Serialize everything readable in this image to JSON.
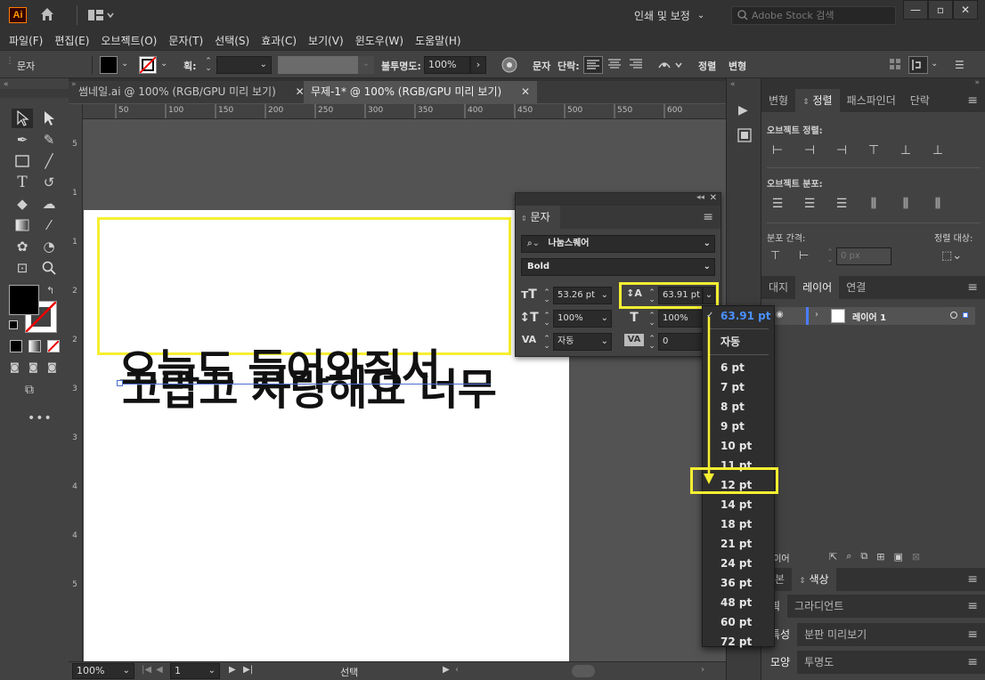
{
  "app": {
    "logo": "Ai",
    "workspace": "인쇄 및 보정",
    "stock_search_placeholder": "Adobe Stock 검색"
  },
  "menu": [
    "파일(F)",
    "편집(E)",
    "오브젝트(O)",
    "문자(T)",
    "선택(S)",
    "효과(C)",
    "보기(V)",
    "윈도우(W)",
    "도움말(H)"
  ],
  "control_bar": {
    "selection_label": "문자",
    "stroke_label": "획:",
    "opacity_label": "불투명도:",
    "opacity_value": "100%",
    "char_label": "문자",
    "para_label": "단락:",
    "align_label": "정렬",
    "transform_label": "변형",
    "fill_color": "#000000",
    "stroke_color": "#ffffff"
  },
  "tabs": [
    {
      "label": "썸네일.ai @ 100% (RGB/GPU 미리 보기)",
      "active": false
    },
    {
      "label": "무제-1* @ 100% (RGB/GPU 미리 보기)",
      "active": true
    }
  ],
  "ruler_top": [
    "50",
    "100",
    "150",
    "200",
    "250",
    "300",
    "350",
    "400",
    "450",
    "500",
    "550",
    "600"
  ],
  "ruler_left": [
    "5",
    "1",
    "1",
    "2",
    "2",
    "3",
    "3",
    "4",
    "4",
    "5"
  ],
  "artboard_text": {
    "line1": "오늘도 들어와줘서",
    "line2": "고맙고 사랑해요 너무"
  },
  "status_bar": {
    "zoom": "100%",
    "page": "1",
    "tool": "선택"
  },
  "char_panel": {
    "title": "문자",
    "font_family": "나눔스퀘어",
    "font_style": "Bold",
    "font_size": "53.26 pt",
    "leading": "63.91 pt",
    "vertical_scale": "100%",
    "horizontal_scale": "100%",
    "kerning": "자동",
    "tracking": "0"
  },
  "leading_dropdown": {
    "selected": "63.91 pt",
    "auto": "자동",
    "options": [
      "6 pt",
      "7 pt",
      "8 pt",
      "9 pt",
      "10 pt",
      "11 pt",
      "12 pt",
      "14 pt",
      "18 pt",
      "21 pt",
      "24 pt",
      "36 pt",
      "48 pt",
      "60 pt",
      "72 pt"
    ],
    "highlighted": "12 pt"
  },
  "right_panel": {
    "tabs1": [
      "변형",
      "정렬",
      "패스파인더",
      "단락"
    ],
    "active_tab1": "정렬",
    "align_objects_label": "오브젝트 정렬:",
    "distribute_objects_label": "오브젝트 분포:",
    "distribute_spacing_label": "분포 간격:",
    "align_to_label": "정렬 대상:",
    "spacing_value": "0 px",
    "tabs2": [
      "대지",
      "레이어",
      "연결"
    ],
    "active_tab2": "레이어",
    "layer_name": "레이어 1",
    "layers_footer": "레이어",
    "tabs3": [
      "견본",
      "색상"
    ],
    "tabs4": [
      "획",
      "그라디언트"
    ],
    "tabs5": [
      "특성",
      "분판 미리보기"
    ],
    "tabs6": [
      "모양",
      "투명도"
    ]
  },
  "colors": {
    "highlight": "#f6ef32",
    "checked": "#4a90ff",
    "layer_color": "#4a7dff"
  }
}
